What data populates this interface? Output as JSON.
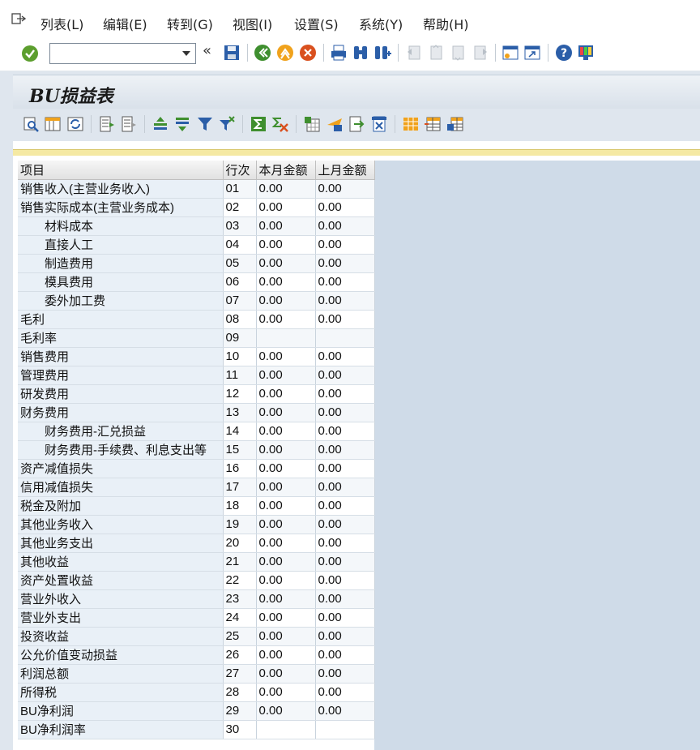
{
  "menu": [
    "列表(L)",
    "编辑(E)",
    "转到(G)",
    "视图(I)",
    "设置(S)",
    "系统(Y)",
    "帮助(H)"
  ],
  "page_title": "BU损益表",
  "table": {
    "headers": [
      "项目",
      "行次",
      "本月金额",
      "上月金额"
    ],
    "rows": [
      {
        "name": "销售收入(主营业务收入)",
        "no": "01",
        "cur": "0.00",
        "prev": "0.00",
        "indent": false
      },
      {
        "name": "销售实际成本(主营业务成本)",
        "no": "02",
        "cur": "0.00",
        "prev": "0.00",
        "indent": false
      },
      {
        "name": "材料成本",
        "no": "03",
        "cur": "0.00",
        "prev": "0.00",
        "indent": true
      },
      {
        "name": "直接人工",
        "no": "04",
        "cur": "0.00",
        "prev": "0.00",
        "indent": true
      },
      {
        "name": "制造费用",
        "no": "05",
        "cur": "0.00",
        "prev": "0.00",
        "indent": true
      },
      {
        "name": "模具费用",
        "no": "06",
        "cur": "0.00",
        "prev": "0.00",
        "indent": true
      },
      {
        "name": "委外加工费",
        "no": "07",
        "cur": "0.00",
        "prev": "0.00",
        "indent": true
      },
      {
        "name": "毛利",
        "no": "08",
        "cur": "0.00",
        "prev": "0.00",
        "indent": false
      },
      {
        "name": "毛利率",
        "no": "09",
        "cur": "",
        "prev": "",
        "indent": false
      },
      {
        "name": "销售费用",
        "no": "10",
        "cur": "0.00",
        "prev": "0.00",
        "indent": false
      },
      {
        "name": "管理费用",
        "no": "11",
        "cur": "0.00",
        "prev": "0.00",
        "indent": false
      },
      {
        "name": "研发费用",
        "no": "12",
        "cur": "0.00",
        "prev": "0.00",
        "indent": false
      },
      {
        "name": "财务费用",
        "no": "13",
        "cur": "0.00",
        "prev": "0.00",
        "indent": false
      },
      {
        "name": "财务费用-汇兑损益",
        "no": "14",
        "cur": "0.00",
        "prev": "0.00",
        "indent": true
      },
      {
        "name": "财务费用-手续费、利息支出等",
        "no": "15",
        "cur": "0.00",
        "prev": "0.00",
        "indent": true
      },
      {
        "name": "资产减值损失",
        "no": "16",
        "cur": "0.00",
        "prev": "0.00",
        "indent": false
      },
      {
        "name": "信用减值损失",
        "no": "17",
        "cur": "0.00",
        "prev": "0.00",
        "indent": false
      },
      {
        "name": "税金及附加",
        "no": "18",
        "cur": "0.00",
        "prev": "0.00",
        "indent": false
      },
      {
        "name": "其他业务收入",
        "no": "19",
        "cur": "0.00",
        "prev": "0.00",
        "indent": false
      },
      {
        "name": "其他业务支出",
        "no": "20",
        "cur": "0.00",
        "prev": "0.00",
        "indent": false
      },
      {
        "name": "其他收益",
        "no": "21",
        "cur": "0.00",
        "prev": "0.00",
        "indent": false
      },
      {
        "name": "资产处置收益",
        "no": "22",
        "cur": "0.00",
        "prev": "0.00",
        "indent": false
      },
      {
        "name": "营业外收入",
        "no": "23",
        "cur": "0.00",
        "prev": "0.00",
        "indent": false
      },
      {
        "name": "营业外支出",
        "no": "24",
        "cur": "0.00",
        "prev": "0.00",
        "indent": false
      },
      {
        "name": "投资收益",
        "no": "25",
        "cur": "0.00",
        "prev": "0.00",
        "indent": false
      },
      {
        "name": "公允价值变动损益",
        "no": "26",
        "cur": "0.00",
        "prev": "0.00",
        "indent": false
      },
      {
        "name": "利润总额",
        "no": "27",
        "cur": "0.00",
        "prev": "0.00",
        "indent": false
      },
      {
        "name": "所得税",
        "no": "28",
        "cur": "0.00",
        "prev": "0.00",
        "indent": false
      },
      {
        "name": "BU净利润",
        "no": "29",
        "cur": "0.00",
        "prev": "0.00",
        "indent": false
      },
      {
        "name": "BU净利润率",
        "no": "30",
        "cur": "",
        "prev": "",
        "indent": false
      }
    ]
  }
}
